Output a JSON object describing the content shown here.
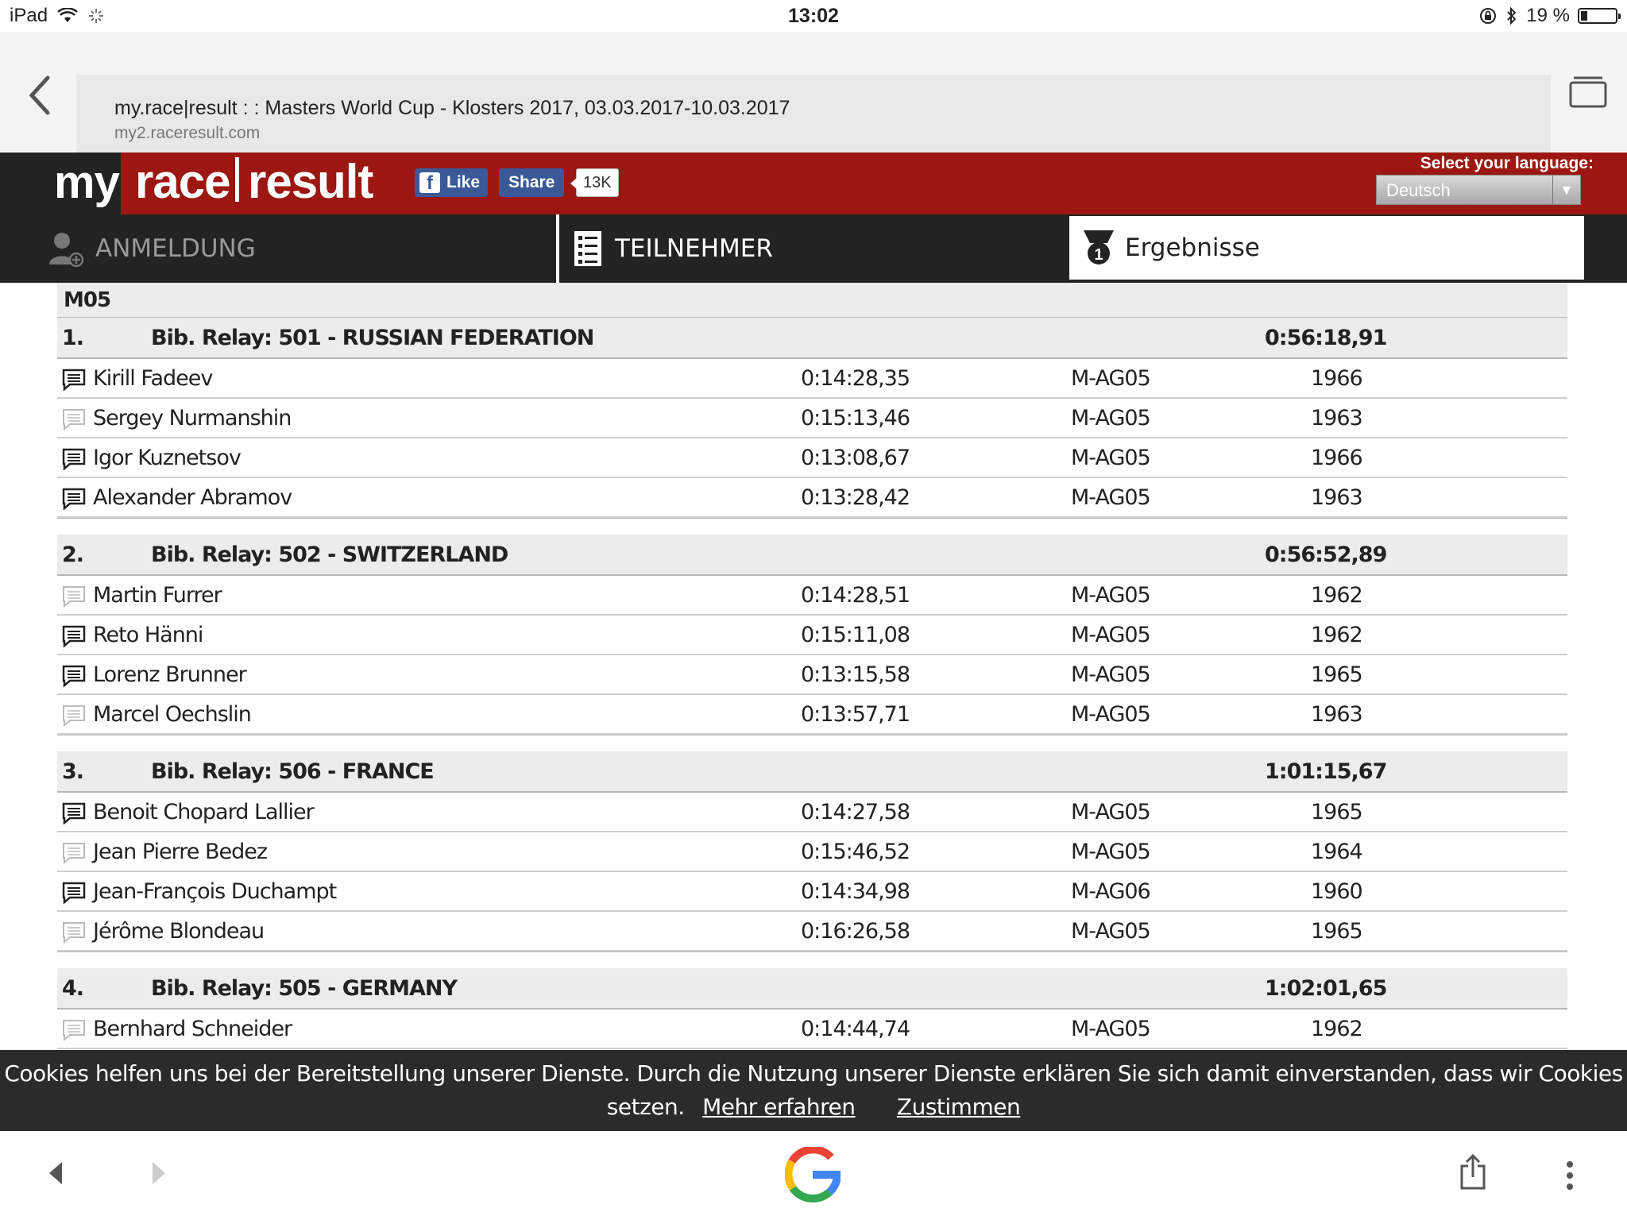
{
  "status_bar": {
    "device": "iPad",
    "time": "13:02",
    "battery": "19 %",
    "battery_level": 0.19
  },
  "browser": {
    "page_title": "my.race|result : : Masters World Cup - Klosters 2017, 03.03.2017-10.03.2017",
    "domain": "my2.raceresult.com"
  },
  "site_header": {
    "logo_my": "my",
    "logo_race": "race",
    "logo_result": "result",
    "fb_like": "Like",
    "fb_share": "Share",
    "fb_count": "13K",
    "language_label": "Select your language:",
    "language_value": "Deutsch"
  },
  "nav": {
    "tab_registration": "ANMELDUNG",
    "tab_participants": "TEILNEHMER",
    "tab_results": "Ergebnisse"
  },
  "results": {
    "category": "M05",
    "teams": [
      {
        "rank": "1.",
        "name": "Bib. Relay: 501 - RUSSIAN FEDERATION",
        "time": "0:56:18,91",
        "members": [
          {
            "name": "Kirill Fadeev",
            "time": "0:14:28,35",
            "cat": "M-AG05",
            "year": "1966",
            "icon": "comment-filled-icon"
          },
          {
            "name": "Sergey Nurmanshin",
            "time": "0:15:13,46",
            "cat": "M-AG05",
            "year": "1963",
            "icon": "comment-light-icon"
          },
          {
            "name": "Igor Kuznetsov",
            "time": "0:13:08,67",
            "cat": "M-AG05",
            "year": "1966",
            "icon": "comment-filled-icon"
          },
          {
            "name": "Alexander Abramov",
            "time": "0:13:28,42",
            "cat": "M-AG05",
            "year": "1963",
            "icon": "comment-filled-icon"
          }
        ]
      },
      {
        "rank": "2.",
        "name": "Bib. Relay: 502 - SWITZERLAND",
        "time": "0:56:52,89",
        "members": [
          {
            "name": "Martin Furrer",
            "time": "0:14:28,51",
            "cat": "M-AG05",
            "year": "1962",
            "icon": "comment-light-icon"
          },
          {
            "name": "Reto Hänni",
            "time": "0:15:11,08",
            "cat": "M-AG05",
            "year": "1962",
            "icon": "comment-filled-icon"
          },
          {
            "name": "Lorenz Brunner",
            "time": "0:13:15,58",
            "cat": "M-AG05",
            "year": "1965",
            "icon": "comment-filled-icon"
          },
          {
            "name": "Marcel Oechslin",
            "time": "0:13:57,71",
            "cat": "M-AG05",
            "year": "1963",
            "icon": "comment-light-icon"
          }
        ]
      },
      {
        "rank": "3.",
        "name": "Bib. Relay: 506 - FRANCE",
        "time": "1:01:15,67",
        "members": [
          {
            "name": "Benoit Chopard Lallier",
            "time": "0:14:27,58",
            "cat": "M-AG05",
            "year": "1965",
            "icon": "comment-filled-icon"
          },
          {
            "name": "Jean Pierre Bedez",
            "time": "0:15:46,52",
            "cat": "M-AG05",
            "year": "1964",
            "icon": "comment-light-icon"
          },
          {
            "name": "Jean-François Duchampt",
            "time": "0:14:34,98",
            "cat": "M-AG06",
            "year": "1960",
            "icon": "comment-filled-icon"
          },
          {
            "name": "Jérôme Blondeau",
            "time": "0:16:26,58",
            "cat": "M-AG05",
            "year": "1965",
            "icon": "comment-light-icon"
          }
        ]
      },
      {
        "rank": "4.",
        "name": "Bib. Relay: 505 - GERMANY",
        "time": "1:02:01,65",
        "members": [
          {
            "name": "Bernhard Schneider",
            "time": "0:14:44,74",
            "cat": "M-AG05",
            "year": "1962",
            "icon": "comment-light-icon"
          }
        ]
      }
    ]
  },
  "cookie_banner": {
    "text_line1": "Cookies helfen uns bei der Bereitstellung unserer Dienste. Durch die Nutzung unserer Dienste erklären Sie sich damit einverstanden, dass wir Cookies",
    "text_line2": "setzen.",
    "learn_more": "Mehr erfahren",
    "agree": "Zustimmen"
  },
  "colors": {
    "header_red": "#9c1711",
    "dark": "#232323",
    "facebook_blue": "#3b5998"
  }
}
